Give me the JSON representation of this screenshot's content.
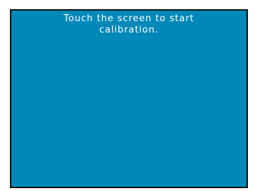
{
  "screen": {
    "message": "Touch the screen to start\ncalibration.",
    "background_color": "#0088b8",
    "text_color": "#ffffff",
    "border_color": "#111111"
  }
}
